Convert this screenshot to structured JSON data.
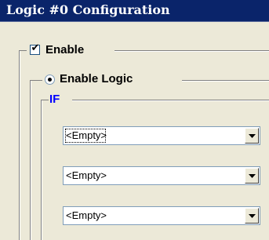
{
  "window": {
    "title": "Logic #0 Configuration"
  },
  "enable": {
    "label": "Enable",
    "checked": true,
    "check_glyph": "✔"
  },
  "logic": {
    "label": "Enable Logic",
    "selected": true
  },
  "if_group": {
    "label": "IF"
  },
  "conditions": [
    {
      "value": "<Empty>"
    },
    {
      "value": "<Empty>"
    },
    {
      "value": "<Empty>"
    }
  ],
  "colors": {
    "title_bar": "#0a246a",
    "face": "#ece9d8",
    "if_label": "#0000ff"
  }
}
